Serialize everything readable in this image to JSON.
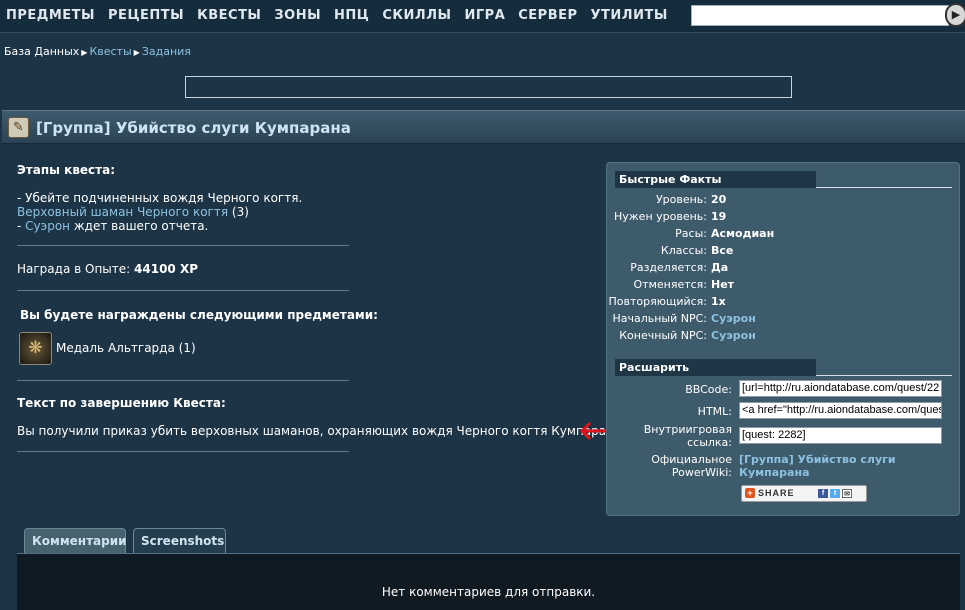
{
  "nav": {
    "items": [
      "ПРЕДМЕТЫ",
      "РЕЦЕПТЫ",
      "КВЕСТЫ",
      "ЗОНЫ",
      "НПЦ",
      "СКИЛЛЫ",
      "ИГРА",
      "СЕРВЕР",
      "УТИЛИТЫ"
    ],
    "search_value": ""
  },
  "breadcrumb": [
    "База Данных",
    "Квесты",
    "Задания"
  ],
  "title": "[Группа] Убийство слуги Кумпарана",
  "stages": {
    "heading": "Этапы квеста:",
    "line1": "- Убейте подчиненных вождя Черного когтя.",
    "target_link": "Верховный шаман Черного когтя",
    "target_count": "(3)",
    "line3_prefix": "- ",
    "npc_link": "Суэрон",
    "line3_suffix": "ждет вашего отчета."
  },
  "reward_xp": {
    "label": "Награда в Опыте:",
    "value": "44100 XP"
  },
  "rewards": {
    "heading": "Вы будете награждены следующими предметами:",
    "item_name": "Медаль Альтгарда (1)"
  },
  "completion": {
    "heading": "Текст по завершению Квеста:",
    "text": "Вы получили приказ убить верховных шаманов, охраняющих вождя Черного когтя Кумпарана."
  },
  "facts": {
    "heading": "Быстрые Факты",
    "rows": [
      {
        "label": "Уровень:",
        "value": "20"
      },
      {
        "label": "Нужен уровень:",
        "value": "19"
      },
      {
        "label": "Расы:",
        "value": "Асмодиан"
      },
      {
        "label": "Классы:",
        "value": "Все"
      },
      {
        "label": "Разделяется:",
        "value": "Да"
      },
      {
        "label": "Отменяется:",
        "value": "Нет"
      },
      {
        "label": "Повторяющийся:",
        "value": "1x"
      },
      {
        "label": "Начальный NPC:",
        "value": "Суэрон"
      },
      {
        "label": "Конечный NPC:",
        "value": "Суэрон"
      }
    ]
  },
  "share": {
    "heading": "Расшарить",
    "bbcode_label": "BBCode:",
    "bbcode_value": "[url=http://ru.aiondatabase.com/quest/22",
    "html_label": "HTML:",
    "html_value": "<a href=\"http://ru.aiondatabase.com/ques",
    "ingame_label_1": "Внутриигровая",
    "ingame_label_2": "ссылка:",
    "ingame_value": "[quest: 2282]",
    "wiki_label_1": "Официальное",
    "wiki_label_2": "PowerWiki:",
    "wiki_link_1": "[Группа] Убийство слуги",
    "wiki_link_2": "Кумпарана",
    "share_button": "SHARE"
  },
  "tabs": [
    "Комментарии",
    "Screenshots"
  ],
  "comments": {
    "empty_text": "Нет комментариев для отправки."
  },
  "colors": {
    "background": "#1c3445",
    "link": "#8cc1e0",
    "arrow": "#e0141a"
  }
}
